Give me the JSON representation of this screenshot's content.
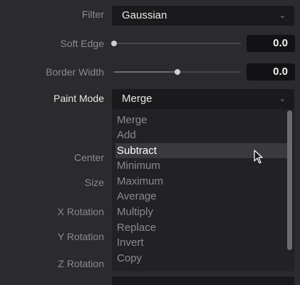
{
  "fields": {
    "filter": {
      "label": "Filter",
      "value": "Gaussian"
    },
    "soft_edge": {
      "label": "Soft Edge",
      "value": "0.0",
      "slider_fraction": 0.0
    },
    "border_width": {
      "label": "Border Width",
      "value": "0.0",
      "slider_fraction": 0.5
    },
    "paint_mode": {
      "label": "Paint Mode",
      "value": "Merge"
    },
    "center": {
      "label": "Center"
    },
    "size": {
      "label": "Size"
    },
    "x_rotation": {
      "label": "X Rotation"
    },
    "y_rotation": {
      "label": "Y Rotation"
    },
    "z_rotation": {
      "label": "Z Rotation"
    }
  },
  "paint_mode_menu": {
    "items": [
      "Merge",
      "Add",
      "Subtract",
      "Minimum",
      "Maximum",
      "Average",
      "Multiply",
      "Replace",
      "Invert",
      "Copy"
    ],
    "hovered": "Subtract"
  },
  "icons": {
    "dropdown": "chevron-down-icon",
    "cursor": "mouse-pointer-icon"
  },
  "colors": {
    "panel_bg": "#2b2b2d",
    "field_bg": "#1a1a1c",
    "highlight": "#3a3a3e"
  }
}
